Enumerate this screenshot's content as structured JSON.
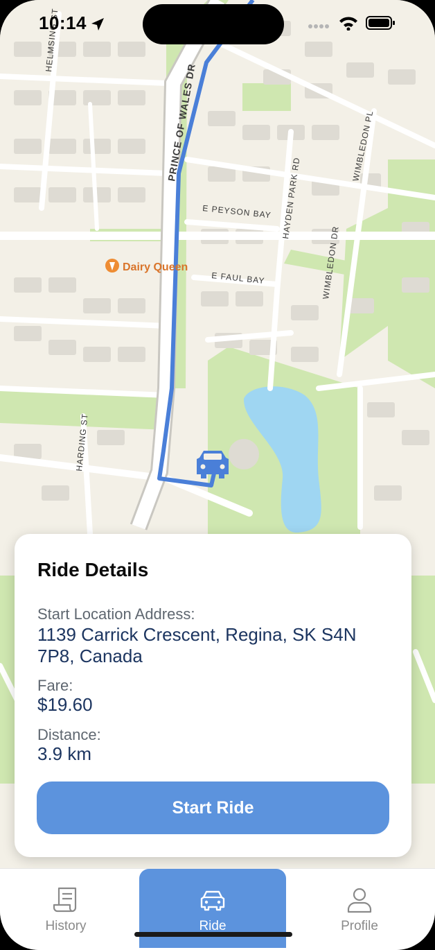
{
  "status_bar": {
    "time": "10:14"
  },
  "map": {
    "labels": {
      "prince_of_wales": "PRINCE OF WALES DR",
      "e_peyson": "E PEYSON BAY",
      "e_faul": "E FAUL BAY",
      "hayden_park": "HAYDEN PARK RD",
      "wimbledon_pl": "WIMBLEDON PL",
      "wimbledon_dr": "WIMBLEDON DR",
      "harding": "HARDING ST",
      "helmsing": "HELMSING ST",
      "poi": "Dairy Queen"
    },
    "colors": {
      "route": "#4a7fd8",
      "water": "#9fd6f2",
      "park": "#cfe7b0",
      "road": "#ffffff",
      "building": "#dedbd3"
    }
  },
  "ride_details": {
    "title": "Ride Details",
    "start_label": "Start Location Address:",
    "start_value": "1139 Carrick Crescent, Regina, SK S4N 7P8, Canada",
    "fare_label": "Fare:",
    "fare_value": "$19.60",
    "distance_label": "Distance:",
    "distance_value": "3.9 km",
    "button_label": "Start Ride"
  },
  "tab_bar": {
    "tabs": [
      {
        "label": "History",
        "icon": "receipt-icon",
        "active": false
      },
      {
        "label": "Ride",
        "icon": "car-icon",
        "active": true
      },
      {
        "label": "Profile",
        "icon": "person-icon",
        "active": false
      }
    ]
  }
}
